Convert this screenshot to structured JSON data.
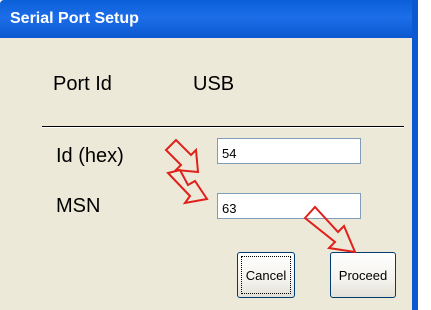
{
  "window": {
    "title": "Serial Port Setup"
  },
  "form": {
    "port_id_label": "Port Id",
    "port_id_value": "USB",
    "id_hex_label": "Id (hex)",
    "id_hex_value": "54",
    "msn_label": "MSN",
    "msn_value": "63"
  },
  "buttons": {
    "cancel_label": "Cancel",
    "proceed_label": "Proceed"
  },
  "colors": {
    "title_bar": "#0b58d0",
    "dialog_background": "#ece9d8",
    "annotation_arrow": "#e0201b"
  },
  "icons": [
    "arrow-annotation-icon",
    "arrow-annotation-icon",
    "arrow-annotation-icon"
  ]
}
